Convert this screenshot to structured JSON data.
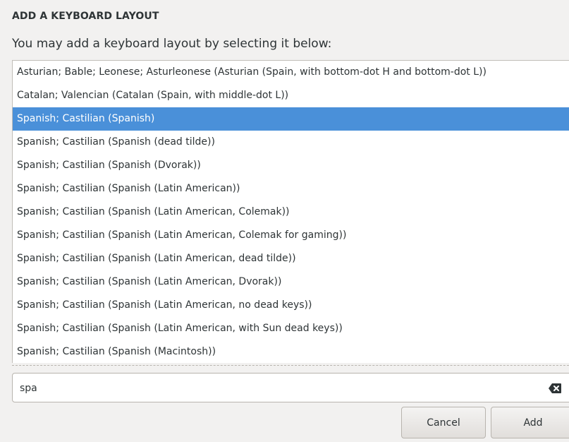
{
  "dialog": {
    "title": "ADD A KEYBOARD LAYOUT",
    "subtitle": "You may add a keyboard layout by selecting it below:"
  },
  "layouts": [
    {
      "label": "Asturian; Bable; Leonese; Asturleonese (Asturian (Spain, with bottom-dot H and bottom-dot L))",
      "selected": false
    },
    {
      "label": "Catalan; Valencian (Catalan (Spain, with middle-dot L))",
      "selected": false
    },
    {
      "label": "Spanish; Castilian (Spanish)",
      "selected": true
    },
    {
      "label": "Spanish; Castilian (Spanish (dead tilde))",
      "selected": false
    },
    {
      "label": "Spanish; Castilian (Spanish (Dvorak))",
      "selected": false
    },
    {
      "label": "Spanish; Castilian (Spanish (Latin American))",
      "selected": false
    },
    {
      "label": "Spanish; Castilian (Spanish (Latin American, Colemak))",
      "selected": false
    },
    {
      "label": "Spanish; Castilian (Spanish (Latin American, Colemak for gaming))",
      "selected": false
    },
    {
      "label": "Spanish; Castilian (Spanish (Latin American, dead tilde))",
      "selected": false
    },
    {
      "label": "Spanish; Castilian (Spanish (Latin American, Dvorak))",
      "selected": false
    },
    {
      "label": "Spanish; Castilian (Spanish (Latin American, no dead keys))",
      "selected": false
    },
    {
      "label": "Spanish; Castilian (Spanish (Latin American, with Sun dead keys))",
      "selected": false
    },
    {
      "label": "Spanish; Castilian (Spanish (Macintosh))",
      "selected": false
    }
  ],
  "search": {
    "value": "spa",
    "clear_icon": "backspace-clear-icon"
  },
  "buttons": {
    "cancel_label": "Cancel",
    "add_label": "Add"
  },
  "colors": {
    "selection": "#4a90d9",
    "background": "#f2f1f0"
  }
}
